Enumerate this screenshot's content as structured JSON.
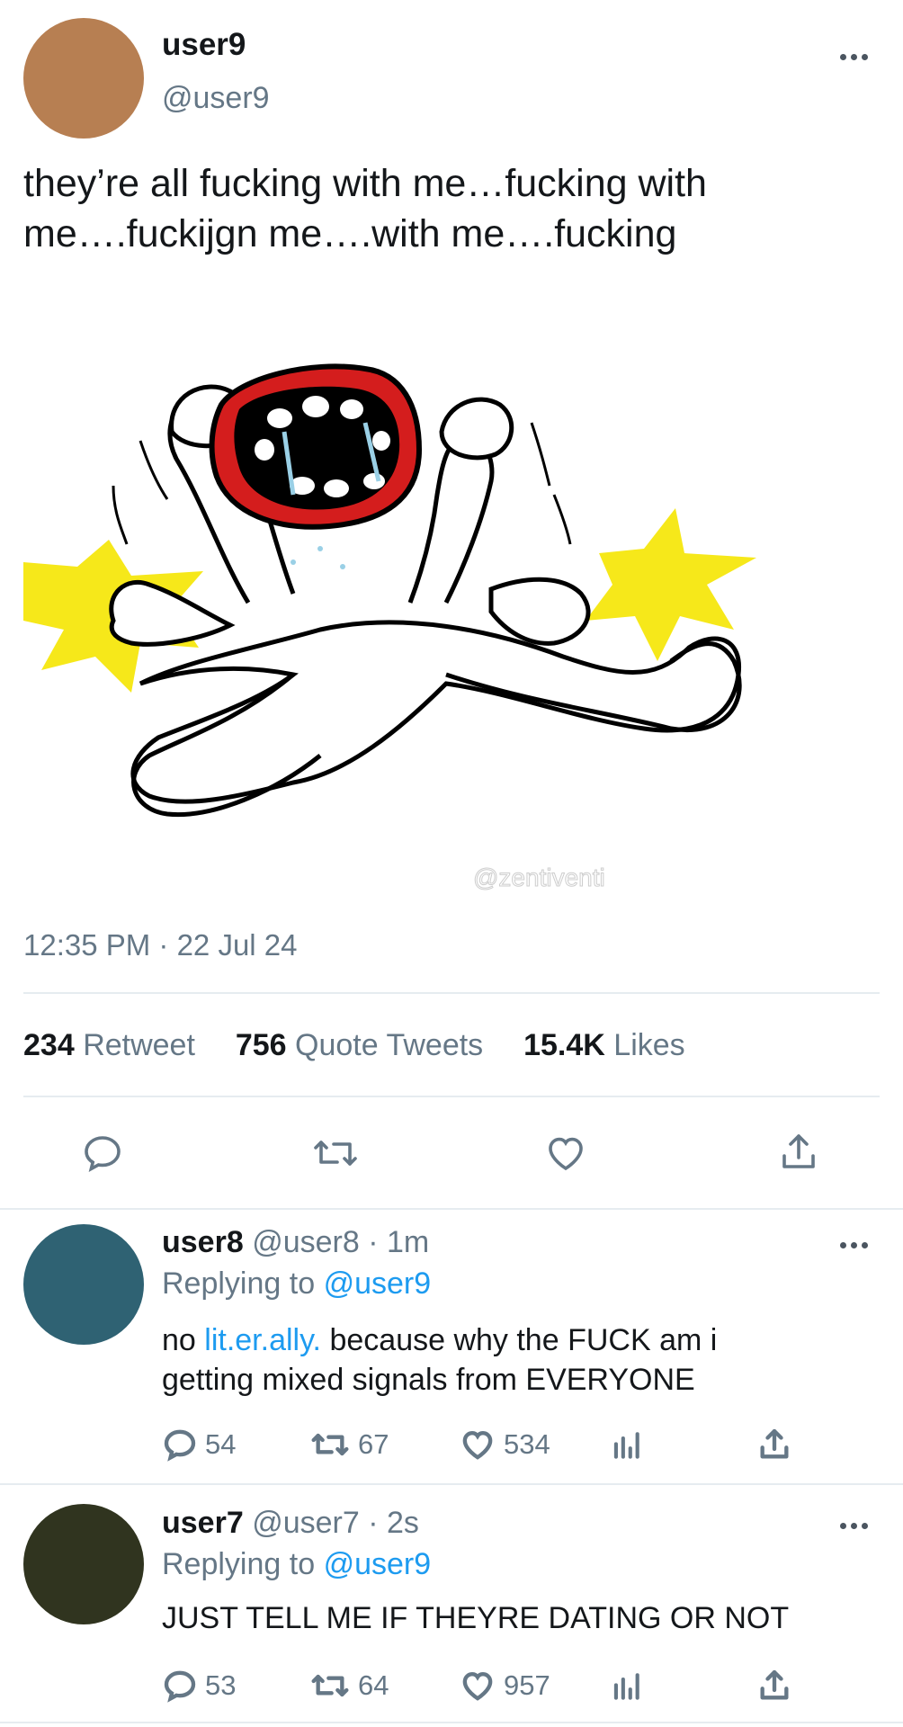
{
  "tweet": {
    "display_name": "user9",
    "handle": "@user9",
    "avatar_color": "#b77f52",
    "text_line1": "they’re all fucking with me…fucking with",
    "text_line2": "me….fuckijgn me….with me….fucking",
    "media_watermark": "@zentiventi",
    "timestamp": "12:35 PM · 22 Jul 24",
    "stats": {
      "retweets_count": "234",
      "retweets_label": "Retweet",
      "quotes_count": "756",
      "quotes_label": "Quote Tweets",
      "likes_count": "15.4K",
      "likes_label": "Likes"
    }
  },
  "replies": [
    {
      "display_name": "user8",
      "meta": "@user8 · 1m",
      "replying_prefix": "Replying to",
      "replying_handle": "@user9",
      "avatar_color": "#2f6273",
      "text_prefix": "no ",
      "text_link": "lit.er.ally.",
      "text_rest": " because why the FUCK am i",
      "text_line2": "getting mixed signals from EVERYONE",
      "replies_count": "54",
      "retweets_count": "67",
      "likes_count": "534"
    },
    {
      "display_name": "user7",
      "meta": "@user7 · 2s",
      "replying_prefix": "Replying to",
      "replying_handle": "@user9",
      "avatar_color": "#30341f",
      "text_line1": "JUST TELL ME IF THEYRE DATING OR NOT",
      "replies_count": "53",
      "retweets_count": "64",
      "likes_count": "957"
    }
  ],
  "colors": {
    "link": "#1d9bf0",
    "muted": "#657786",
    "divider": "#e6ecf0"
  }
}
